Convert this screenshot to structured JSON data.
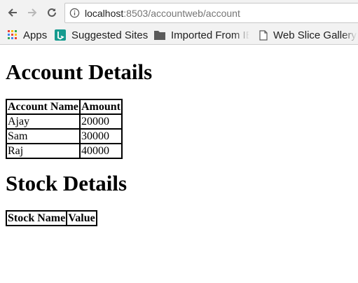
{
  "browser": {
    "url_host": "localhost",
    "url_path": ":8503/accountweb/account",
    "bookmarks": [
      {
        "label": "Apps",
        "icon": "apps-grid-icon"
      },
      {
        "label": "Suggested Sites",
        "icon": "bing-icon"
      },
      {
        "label": "Imported From IE",
        "icon": "folder-icon"
      },
      {
        "label": "Web Slice Gallery",
        "icon": "page-icon"
      }
    ]
  },
  "page": {
    "account_heading": "Account Details",
    "account_table": {
      "headers": [
        "Account Name",
        "Amount"
      ],
      "rows": [
        [
          "Ajay",
          "20000"
        ],
        [
          "Sam",
          "30000"
        ],
        [
          "Raj",
          "40000"
        ]
      ]
    },
    "stock_heading": "Stock Details",
    "stock_table": {
      "headers": [
        "Stock Name",
        "Value"
      ],
      "rows": []
    }
  },
  "colors": {
    "bing": "#169b8f",
    "apps_dots": [
      "#e94235",
      "#fbbc04",
      "#34a853",
      "#4285f4"
    ]
  }
}
